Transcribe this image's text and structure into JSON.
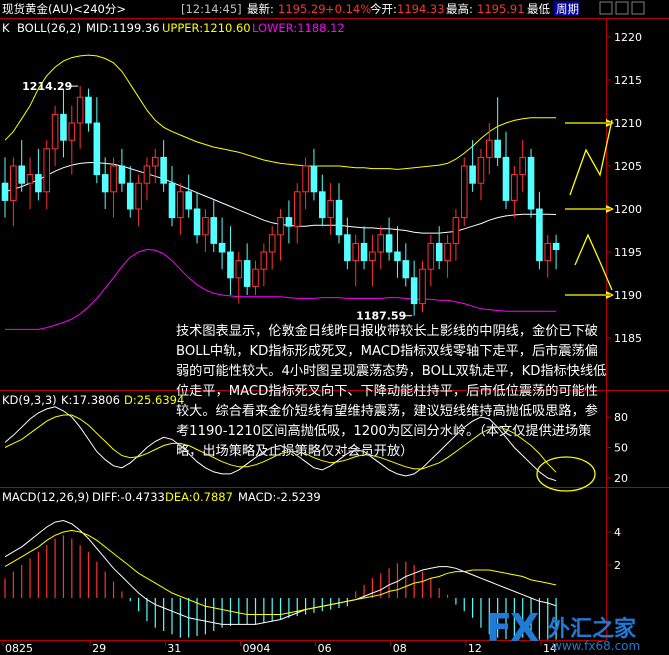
{
  "header": {
    "instrument": "现货黄金(AU)<240分>",
    "time": "[12:14:45]",
    "latest_label": "最新:",
    "latest_value": "1195.29",
    "change": "+0.14%",
    "open_label": "今开:",
    "open_value": "1194.33",
    "high_label": "最高:",
    "high_value": "1195.91",
    "low_label": "最低",
    "period_label": "周期"
  },
  "colors": {
    "up": "#ff3232",
    "down": "#54ffff",
    "mid": "#ffffff",
    "upper": "#ffff00",
    "lower": "#ff00ff",
    "axis": "#b40000",
    "kd_k": "#ffffff",
    "kd_d": "#ffff00",
    "note": "#ffffff",
    "watermark": "#1f7ad8"
  },
  "boll_legend": {
    "k_label": "K",
    "name": "BOLL(26,2)",
    "mid": "MID:1199.36",
    "upper": "UPPER:1210.60",
    "lower": "LOWER:1188.12"
  },
  "kd_legend": {
    "name": "KD(9,3,3)",
    "k": "K:17.3806",
    "d": "D:25.6394"
  },
  "macd_legend": {
    "name": "MACD(12,26,9)",
    "diff": "DIFF:-0.4733",
    "dea": "DEA:0.7887",
    "macd": "MACD:-2.5239"
  },
  "note": "技术图表显示，伦敦金日线昨日报收带较长上影线的中阴线，金价已下破BOLL中轨，KD指标形成死叉，MACD指标双线零轴下走平，后市震荡偏弱的可能性较大。4小时图呈现震荡态势，BOLL双轨走平，KD指标快线低位走平，MACD指标死叉向下、下降动能柱持平，后市低位震荡的可能性较大。综合看来金价短线有望维持震荡，建议短线维持高抛低吸思路，参考1190-1210区间高抛低吸，1200为区间分水岭。（本文仅提供进场策略，出场策略及止损策略仅对会员开放）",
  "watermark": {
    "brand": "FX",
    "cn": "外汇之家",
    "url": "www.fx68.com"
  },
  "chart_data": [
    {
      "type": "candlestick",
      "title": "BOLL(26,2)",
      "y_ticks": [
        1185,
        1190,
        1195,
        1200,
        1205,
        1210,
        1215,
        1220
      ],
      "ylim": [
        1182,
        1222
      ],
      "x_ticks": [
        "0825",
        "29",
        "31",
        "0904",
        "06",
        "08",
        "12",
        "14"
      ],
      "annotations": [
        {
          "text": "1214.29",
          "value": 1214.29
        },
        {
          "text": "1187.59",
          "value": 1187.59
        }
      ],
      "arrow_levels": [
        1210,
        1200,
        1190
      ],
      "candles": [
        {
          "o": 1203,
          "h": 1206,
          "l": 1199,
          "c": 1201
        },
        {
          "o": 1201,
          "h": 1206,
          "l": 1198,
          "c": 1205
        },
        {
          "o": 1205,
          "h": 1208,
          "l": 1202,
          "c": 1203
        },
        {
          "o": 1203,
          "h": 1206,
          "l": 1200,
          "c": 1204
        },
        {
          "o": 1204,
          "h": 1207,
          "l": 1201,
          "c": 1202
        },
        {
          "o": 1202,
          "h": 1208,
          "l": 1200,
          "c": 1207
        },
        {
          "o": 1207,
          "h": 1212,
          "l": 1205,
          "c": 1211
        },
        {
          "o": 1211,
          "h": 1214,
          "l": 1206,
          "c": 1208
        },
        {
          "o": 1208,
          "h": 1212,
          "l": 1204,
          "c": 1210
        },
        {
          "o": 1210,
          "h": 1214.29,
          "l": 1207,
          "c": 1213
        },
        {
          "o": 1213,
          "h": 1214,
          "l": 1209,
          "c": 1210
        },
        {
          "o": 1210,
          "h": 1213,
          "l": 1203,
          "c": 1204
        },
        {
          "o": 1204,
          "h": 1206,
          "l": 1200,
          "c": 1202
        },
        {
          "o": 1202,
          "h": 1206,
          "l": 1199,
          "c": 1205
        },
        {
          "o": 1205,
          "h": 1207,
          "l": 1202,
          "c": 1203
        },
        {
          "o": 1203,
          "h": 1205,
          "l": 1199,
          "c": 1200
        },
        {
          "o": 1200,
          "h": 1204,
          "l": 1198,
          "c": 1203
        },
        {
          "o": 1203,
          "h": 1206,
          "l": 1201,
          "c": 1205
        },
        {
          "o": 1205,
          "h": 1207,
          "l": 1203,
          "c": 1206
        },
        {
          "o": 1206,
          "h": 1208,
          "l": 1202,
          "c": 1203
        },
        {
          "o": 1203,
          "h": 1205,
          "l": 1198,
          "c": 1199
        },
        {
          "o": 1199,
          "h": 1203,
          "l": 1197,
          "c": 1202
        },
        {
          "o": 1202,
          "h": 1204,
          "l": 1199,
          "c": 1200
        },
        {
          "o": 1200,
          "h": 1202,
          "l": 1196,
          "c": 1197
        },
        {
          "o": 1197,
          "h": 1200,
          "l": 1195,
          "c": 1199
        },
        {
          "o": 1199,
          "h": 1201,
          "l": 1195,
          "c": 1196
        },
        {
          "o": 1196,
          "h": 1199,
          "l": 1193,
          "c": 1195
        },
        {
          "o": 1195,
          "h": 1198,
          "l": 1190,
          "c": 1192
        },
        {
          "o": 1192,
          "h": 1195,
          "l": 1189,
          "c": 1194
        },
        {
          "o": 1194,
          "h": 1196,
          "l": 1190,
          "c": 1191
        },
        {
          "o": 1191,
          "h": 1194,
          "l": 1190,
          "c": 1193
        },
        {
          "o": 1193,
          "h": 1196,
          "l": 1191,
          "c": 1195
        },
        {
          "o": 1195,
          "h": 1198,
          "l": 1193,
          "c": 1197
        },
        {
          "o": 1197,
          "h": 1200,
          "l": 1194,
          "c": 1199
        },
        {
          "o": 1199,
          "h": 1201,
          "l": 1196,
          "c": 1198
        },
        {
          "o": 1198,
          "h": 1203,
          "l": 1196,
          "c": 1202
        },
        {
          "o": 1202,
          "h": 1206,
          "l": 1200,
          "c": 1205
        },
        {
          "o": 1205,
          "h": 1207,
          "l": 1201,
          "c": 1202
        },
        {
          "o": 1202,
          "h": 1204,
          "l": 1198,
          "c": 1199
        },
        {
          "o": 1199,
          "h": 1203,
          "l": 1197,
          "c": 1201
        },
        {
          "o": 1201,
          "h": 1203,
          "l": 1196,
          "c": 1197
        },
        {
          "o": 1197,
          "h": 1199,
          "l": 1193,
          "c": 1194
        },
        {
          "o": 1194,
          "h": 1197,
          "l": 1191,
          "c": 1196
        },
        {
          "o": 1196,
          "h": 1198,
          "l": 1193,
          "c": 1194
        },
        {
          "o": 1194,
          "h": 1197,
          "l": 1191,
          "c": 1195
        },
        {
          "o": 1195,
          "h": 1198,
          "l": 1193,
          "c": 1197
        },
        {
          "o": 1197,
          "h": 1199,
          "l": 1194,
          "c": 1195
        },
        {
          "o": 1195,
          "h": 1198,
          "l": 1192,
          "c": 1194
        },
        {
          "o": 1194,
          "h": 1196,
          "l": 1191,
          "c": 1192
        },
        {
          "o": 1192,
          "h": 1194,
          "l": 1187.59,
          "c": 1189
        },
        {
          "o": 1189,
          "h": 1194,
          "l": 1188,
          "c": 1193
        },
        {
          "o": 1193,
          "h": 1197,
          "l": 1191,
          "c": 1196
        },
        {
          "o": 1196,
          "h": 1198,
          "l": 1193,
          "c": 1194
        },
        {
          "o": 1194,
          "h": 1197,
          "l": 1192,
          "c": 1196
        },
        {
          "o": 1196,
          "h": 1200,
          "l": 1194,
          "c": 1199
        },
        {
          "o": 1199,
          "h": 1206,
          "l": 1198,
          "c": 1205
        },
        {
          "o": 1205,
          "h": 1208,
          "l": 1202,
          "c": 1203
        },
        {
          "o": 1203,
          "h": 1207,
          "l": 1201,
          "c": 1206
        },
        {
          "o": 1206,
          "h": 1210,
          "l": 1204,
          "c": 1208
        },
        {
          "o": 1208,
          "h": 1213,
          "l": 1205,
          "c": 1206
        },
        {
          "o": 1206,
          "h": 1209,
          "l": 1200,
          "c": 1201
        },
        {
          "o": 1201,
          "h": 1205,
          "l": 1199,
          "c": 1204
        },
        {
          "o": 1204,
          "h": 1208,
          "l": 1202,
          "c": 1206
        },
        {
          "o": 1206,
          "h": 1207,
          "l": 1199,
          "c": 1200
        },
        {
          "o": 1200,
          "h": 1202,
          "l": 1193,
          "c": 1194
        },
        {
          "o": 1194,
          "h": 1197,
          "l": 1192,
          "c": 1196
        },
        {
          "o": 1196,
          "h": 1197,
          "l": 1193,
          "c": 1195.29
        }
      ],
      "boll_mid": [
        1202,
        1202.3,
        1202.6,
        1203,
        1203.4,
        1203.9,
        1204.4,
        1204.8,
        1205.1,
        1205.3,
        1205.4,
        1205.4,
        1205.3,
        1205.2,
        1205,
        1204.7,
        1204.4,
        1204.1,
        1203.8,
        1203.5,
        1203.1,
        1202.7,
        1202.3,
        1201.9,
        1201.5,
        1201.1,
        1200.7,
        1200.3,
        1199.9,
        1199.5,
        1199.1,
        1198.7,
        1198.4,
        1198.2,
        1198.1,
        1198,
        1198,
        1198.1,
        1198.1,
        1198.1,
        1198.1,
        1198,
        1197.9,
        1197.8,
        1197.8,
        1197.7,
        1197.7,
        1197.6,
        1197.5,
        1197.3,
        1197.2,
        1197.2,
        1197.2,
        1197.3,
        1197.4,
        1197.7,
        1198,
        1198.3,
        1198.7,
        1199,
        1199.2,
        1199.3,
        1199.4,
        1199.4,
        1199.4,
        1199.4,
        1199.36
      ],
      "boll_upper": [
        1208,
        1209,
        1210.5,
        1212,
        1214,
        1215.5,
        1216.5,
        1217.2,
        1217.6,
        1217.8,
        1217.9,
        1217.8,
        1217.5,
        1217,
        1216,
        1214.5,
        1213,
        1211.5,
        1210.3,
        1209.5,
        1209,
        1208.6,
        1208.2,
        1207.8,
        1207.5,
        1207.2,
        1207,
        1206.8,
        1206.6,
        1206.3,
        1206,
        1205.7,
        1205.5,
        1205.3,
        1205.2,
        1205.1,
        1205,
        1205,
        1205,
        1205,
        1205,
        1204.9,
        1204.8,
        1204.8,
        1204.7,
        1204.7,
        1204.7,
        1204.6,
        1204.7,
        1204.8,
        1204.9,
        1205,
        1205.1,
        1205.3,
        1205.8,
        1206.5,
        1207.3,
        1208.2,
        1209,
        1209.6,
        1210,
        1210.3,
        1210.5,
        1210.6,
        1210.6,
        1210.6,
        1210.6
      ],
      "boll_lower": [
        1186,
        1186,
        1186,
        1186,
        1186,
        1186.2,
        1186.5,
        1186.8,
        1187.2,
        1187.8,
        1188.6,
        1189.6,
        1190.8,
        1192,
        1193.3,
        1194.4,
        1195,
        1195.3,
        1195.2,
        1194.8,
        1194,
        1193,
        1192,
        1191.2,
        1190.6,
        1190.2,
        1190,
        1189.9,
        1189.8,
        1189.8,
        1189.8,
        1189.8,
        1189.8,
        1189.8,
        1189.7,
        1189.6,
        1189.6,
        1189.6,
        1189.7,
        1189.7,
        1189.7,
        1189.6,
        1189.6,
        1189.6,
        1189.6,
        1189.6,
        1189.7,
        1189.7,
        1189.6,
        1189.5,
        1189.5,
        1189.5,
        1189.4,
        1189.4,
        1189.2,
        1189,
        1188.7,
        1188.4,
        1188.3,
        1188.2,
        1188.1,
        1188.1,
        1188.1,
        1188.1,
        1188.1,
        1188.1,
        1188.12
      ]
    },
    {
      "type": "line",
      "title": "KD(9,3,3)",
      "y_ticks": [
        20,
        50,
        80
      ],
      "ylim": [
        10,
        100
      ],
      "series": [
        {
          "name": "K",
          "values": [
            55,
            62,
            70,
            78,
            84,
            88,
            90,
            86,
            80,
            70,
            58,
            46,
            38,
            32,
            30,
            35,
            42,
            50,
            56,
            60,
            58,
            52,
            44,
            36,
            30,
            26,
            24,
            24,
            28,
            34,
            40,
            46,
            50,
            52,
            48,
            42,
            36,
            30,
            28,
            32,
            38,
            44,
            48,
            46,
            40,
            34,
            28,
            24,
            22,
            24,
            30,
            38,
            46,
            54,
            62,
            70,
            76,
            80,
            78,
            70,
            60,
            50,
            42,
            34,
            26,
            20,
            17.38
          ]
        },
        {
          "name": "D",
          "values": [
            50,
            54,
            58,
            64,
            70,
            76,
            80,
            82,
            82,
            78,
            72,
            64,
            56,
            48,
            42,
            40,
            41,
            44,
            48,
            52,
            54,
            54,
            52,
            48,
            44,
            40,
            36,
            33,
            31,
            31,
            33,
            36,
            40,
            44,
            46,
            46,
            44,
            40,
            37,
            35,
            36,
            38,
            41,
            43,
            42,
            40,
            37,
            34,
            31,
            29,
            29,
            32,
            35,
            40,
            46,
            52,
            58,
            64,
            68,
            70,
            68,
            64,
            58,
            52,
            44,
            34,
            25.64
          ]
        }
      ]
    },
    {
      "type": "bar",
      "title": "MACD(12,26,9)",
      "y_ticks": [
        4,
        2
      ],
      "ylim": [
        -3.5,
        5.5
      ],
      "values": [
        1.2,
        1.6,
        2.0,
        2.4,
        2.8,
        3.2,
        3.6,
        3.8,
        3.6,
        3.2,
        2.8,
        2.2,
        1.6,
        1.0,
        0.4,
        -0.2,
        -0.8,
        -1.4,
        -1.8,
        -2.0,
        -2.2,
        -2.4,
        -2.4,
        -2.3,
        -2.2,
        -2.0,
        -1.8,
        -1.7,
        -1.6,
        -1.6,
        -1.6,
        -1.5,
        -1.4,
        -1.3,
        -1.2,
        -1.1,
        -1.0,
        -0.9,
        -0.8,
        -0.7,
        -0.6,
        -0.5,
        0.4,
        0.8,
        1.2,
        1.5,
        1.8,
        2.1,
        2.2,
        2.0,
        1.6,
        1.2,
        0.6,
        0.2,
        -0.4,
        -0.8,
        -1.2,
        -1.8,
        -2.2,
        -2.4,
        -2.5,
        -2.5,
        -2.4,
        -2.5,
        -2.52,
        -2.52,
        -2.5239
      ],
      "series": [
        {
          "name": "DIFF",
          "values": [
            2.5,
            2.8,
            3.1,
            3.5,
            3.9,
            4.3,
            4.6,
            4.7,
            4.5,
            4.1,
            3.6,
            3.0,
            2.4,
            1.8,
            1.3,
            0.8,
            0.3,
            -0.1,
            -0.4,
            -0.6,
            -0.8,
            -1.0,
            -1.2,
            -1.3,
            -1.4,
            -1.5,
            -1.6,
            -1.6,
            -1.6,
            -1.6,
            -1.6,
            -1.5,
            -1.4,
            -1.3,
            -1.1,
            -0.9,
            -0.7,
            -0.6,
            -0.5,
            -0.4,
            -0.3,
            -0.2,
            -0.1,
            0.1,
            0.3,
            0.5,
            0.8,
            1.0,
            1.3,
            1.5,
            1.7,
            1.8,
            1.9,
            1.9,
            1.8,
            1.6,
            1.4,
            1.2,
            1.0,
            0.8,
            0.6,
            0.4,
            0.2,
            0.0,
            -0.2,
            -0.3,
            -0.4733
          ]
        },
        {
          "name": "DEA",
          "values": [
            1.9,
            2.2,
            2.5,
            2.8,
            3.1,
            3.5,
            3.8,
            4.0,
            4.1,
            4.0,
            3.8,
            3.5,
            3.1,
            2.7,
            2.3,
            1.9,
            1.5,
            1.2,
            0.9,
            0.6,
            0.3,
            0.1,
            -0.1,
            -0.3,
            -0.5,
            -0.6,
            -0.7,
            -0.8,
            -0.9,
            -1.0,
            -1.0,
            -1.0,
            -1.0,
            -1.0,
            -0.9,
            -0.8,
            -0.7,
            -0.6,
            -0.5,
            -0.4,
            -0.3,
            -0.2,
            -0.1,
            0.0,
            0.1,
            0.2,
            0.4,
            0.5,
            0.7,
            0.9,
            1.0,
            1.2,
            1.3,
            1.5,
            1.6,
            1.6,
            1.7,
            1.7,
            1.7,
            1.6,
            1.5,
            1.4,
            1.3,
            1.1,
            1.0,
            0.9,
            0.7887
          ]
        }
      ]
    }
  ]
}
